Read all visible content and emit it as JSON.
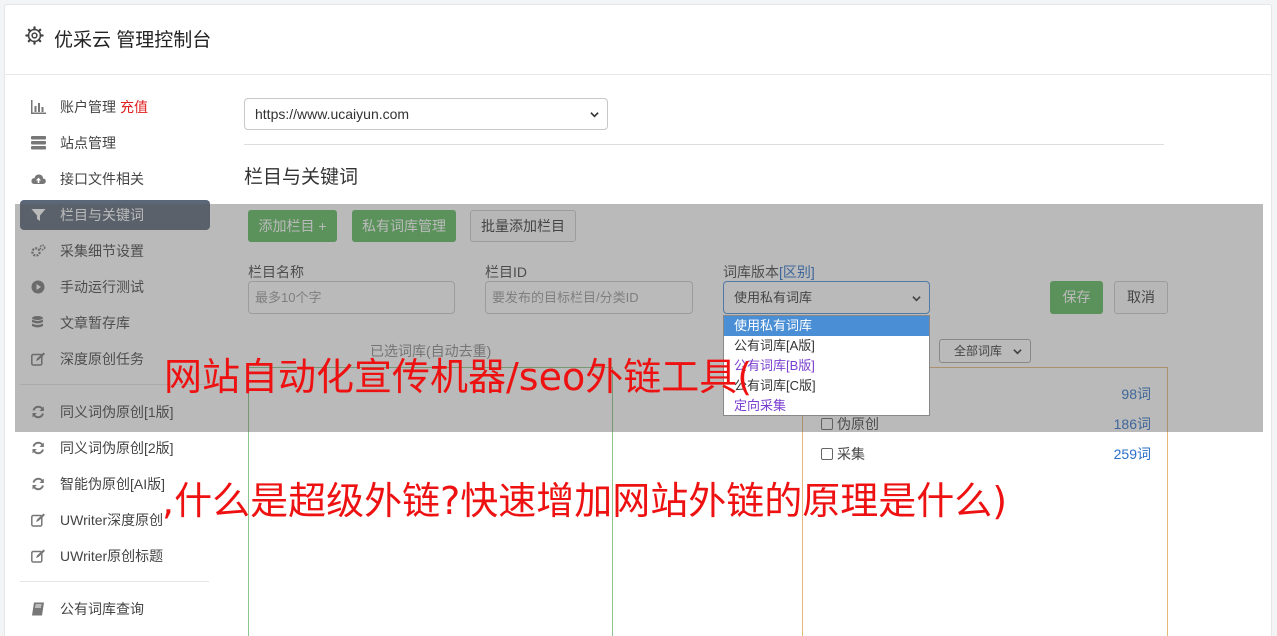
{
  "header": {
    "title": "优采云 管理控制台",
    "icon": "gear-icon"
  },
  "sidebar": {
    "items": [
      {
        "label": "账户管理",
        "icon": "bar-chart-icon",
        "extra": "充值"
      },
      {
        "label": "站点管理",
        "icon": "server-icon"
      },
      {
        "label": "接口文件相关",
        "icon": "cloud-upload-icon"
      },
      {
        "label": "栏目与关键词",
        "icon": "filter-icon",
        "active": true
      },
      {
        "label": "采集细节设置",
        "icon": "cogs-icon"
      },
      {
        "label": "手动运行测试",
        "icon": "play-circle-icon"
      },
      {
        "label": "文章暂存库",
        "icon": "database-icon"
      },
      {
        "label": "深度原创任务",
        "icon": "edit-icon"
      }
    ],
    "items2": [
      {
        "label": "同义词伪原创[1版]",
        "icon": "refresh-icon"
      },
      {
        "label": "同义词伪原创[2版]",
        "icon": "refresh-icon"
      },
      {
        "label": "智能伪原创[AI版]",
        "icon": "refresh-icon"
      },
      {
        "label": "UWriter深度原创",
        "icon": "edit-icon"
      },
      {
        "label": "UWriter原创标题",
        "icon": "edit-icon"
      }
    ],
    "items3": [
      {
        "label": "公有词库查询",
        "icon": "book-icon"
      }
    ]
  },
  "main": {
    "site_select": "https://www.ucaiyun.com",
    "section_title": "栏目与关键词",
    "buttons": {
      "add_column": "添加栏目 +",
      "private_lib": "私有词库管理",
      "batch_add": "批量添加栏目",
      "save": "保存",
      "cancel": "取消"
    },
    "form": {
      "name_label": "栏目名称",
      "name_placeholder": "最多10个字",
      "id_label": "栏目ID",
      "id_placeholder": "要发布的目标栏目/分类ID",
      "version_label": "词库版本",
      "version_link": "[区别]",
      "version_value": "使用私有词库",
      "version_options": [
        "使用私有词库",
        "公有词库[A版]",
        "公有词库[B版]",
        "公有词库[C版]",
        "定向采集"
      ]
    },
    "chosen_label": "已选词库(自动去重)",
    "lib_filter": "全部词库",
    "libs": [
      {
        "name": "",
        "count": "98词"
      },
      {
        "name": "伪原创",
        "count": "186词"
      },
      {
        "name": "采集",
        "count": "259词"
      }
    ]
  },
  "watermark": {
    "line1": "网站自动化宣传机器/seo外链工具(",
    "line2": ",什么是超级外链?快速增加网站外链的原理是什么)"
  },
  "colors": {
    "active": "#5a6778",
    "green": "#5cb85c",
    "link": "#2a6fc9",
    "red": "#ee1111"
  }
}
